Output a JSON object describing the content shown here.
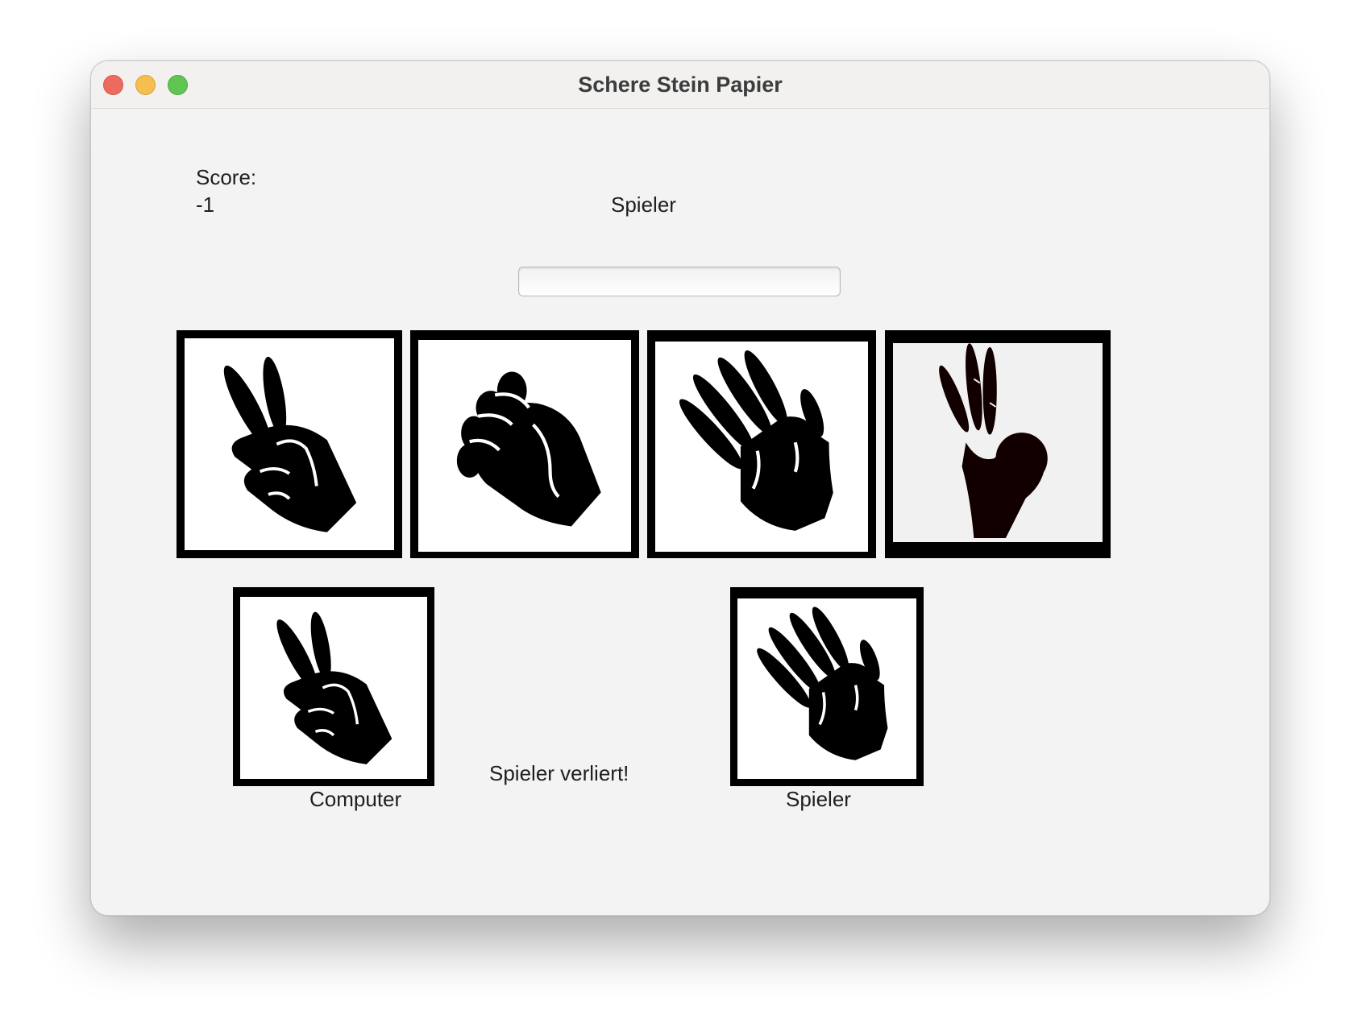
{
  "window": {
    "title": "Schere Stein Papier"
  },
  "score": {
    "label": "Score:",
    "value": "-1"
  },
  "player": {
    "name_label": "Spieler",
    "name_input_value": ""
  },
  "choices": [
    {
      "name": "scissors",
      "icon": "scissors-hand-icon"
    },
    {
      "name": "rock",
      "icon": "rock-fist-icon"
    },
    {
      "name": "paper",
      "icon": "paper-hand-icon"
    },
    {
      "name": "ok",
      "icon": "ok-hand-icon"
    }
  ],
  "result": {
    "computer_choice_icon": "scissors-hand-icon",
    "computer_label": "Computer",
    "player_choice_icon": "paper-hand-icon",
    "player_label": "Spieler",
    "outcome_text": "Spieler verliert!"
  },
  "colors": {
    "close": "#ed6a5e",
    "minimize": "#f5bf4f",
    "maximize": "#61c554",
    "window_bg": "#f3f3f3",
    "tile_border": "#000000"
  }
}
